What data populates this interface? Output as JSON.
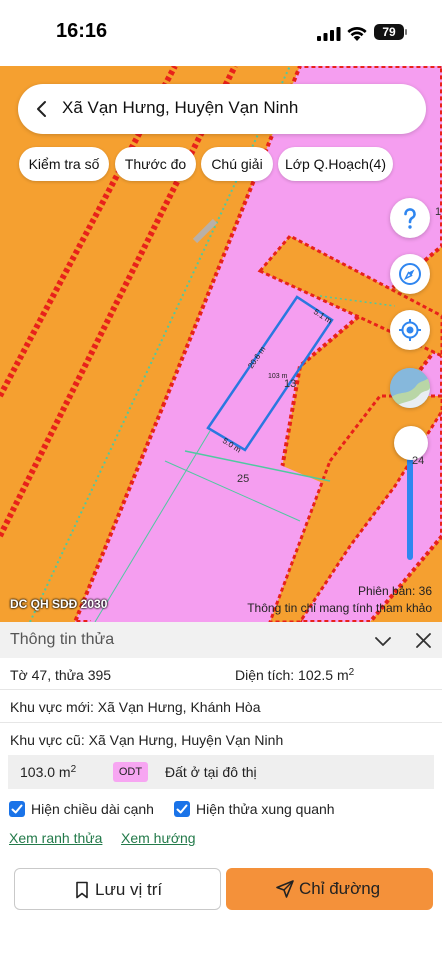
{
  "status_bar": {
    "time": "16:16",
    "battery": "79"
  },
  "map": {
    "search_title": "Xã Vạn Hưng, Huyện Vạn Ninh",
    "chips": [
      "Kiểm tra số",
      "Thước đo",
      "Chú giải",
      "Lớp Q.Hoạch(4)"
    ],
    "edge_label_top": "1",
    "edge_label_side": "24",
    "legend_name": "DC QH SDĐ 2030",
    "version": "Phiên bản: 36",
    "disclaimer": "Thông tin chỉ mang tính tham khảo",
    "parcel_labels": {
      "edge_top": "5.1 m",
      "edge_side": "20.6 m",
      "edge_bottom": "5.0 m",
      "area": "103 m",
      "parcel_main": "13",
      "parcel_below": "25"
    },
    "colors": {
      "residential": "#f59ef0",
      "planning": "#f5a030",
      "road_edge": "#e8211a",
      "boundary": "#4fc9a0",
      "selection": "#2a78e0"
    }
  },
  "panel": {
    "title": "Thông tin thửa",
    "parcel": "Tờ 47, thửa 395",
    "area_label": "Diện tích: 102.5 m",
    "area_sup": "2",
    "new_area": "Khu vực mới:  Xã Vạn Hưng, Khánh Hòa",
    "old_area": "Khu vực cũ:  Xã Vạn Hưng, Huyện Vạn Ninh",
    "land_use": {
      "area": "103.0 m",
      "area_sup": "2",
      "code": "ODT",
      "desc": "Đất ở tại đô thị"
    },
    "options": [
      {
        "label": "Hiện chiều dài cạnh",
        "checked": true
      },
      {
        "label": "Hiện thửa xung quanh",
        "checked": true
      }
    ],
    "links": [
      "Xem ranh thửa",
      "Xem hướng"
    ],
    "save_label": "Lưu vị trí",
    "route_label": "Chỉ đường"
  }
}
